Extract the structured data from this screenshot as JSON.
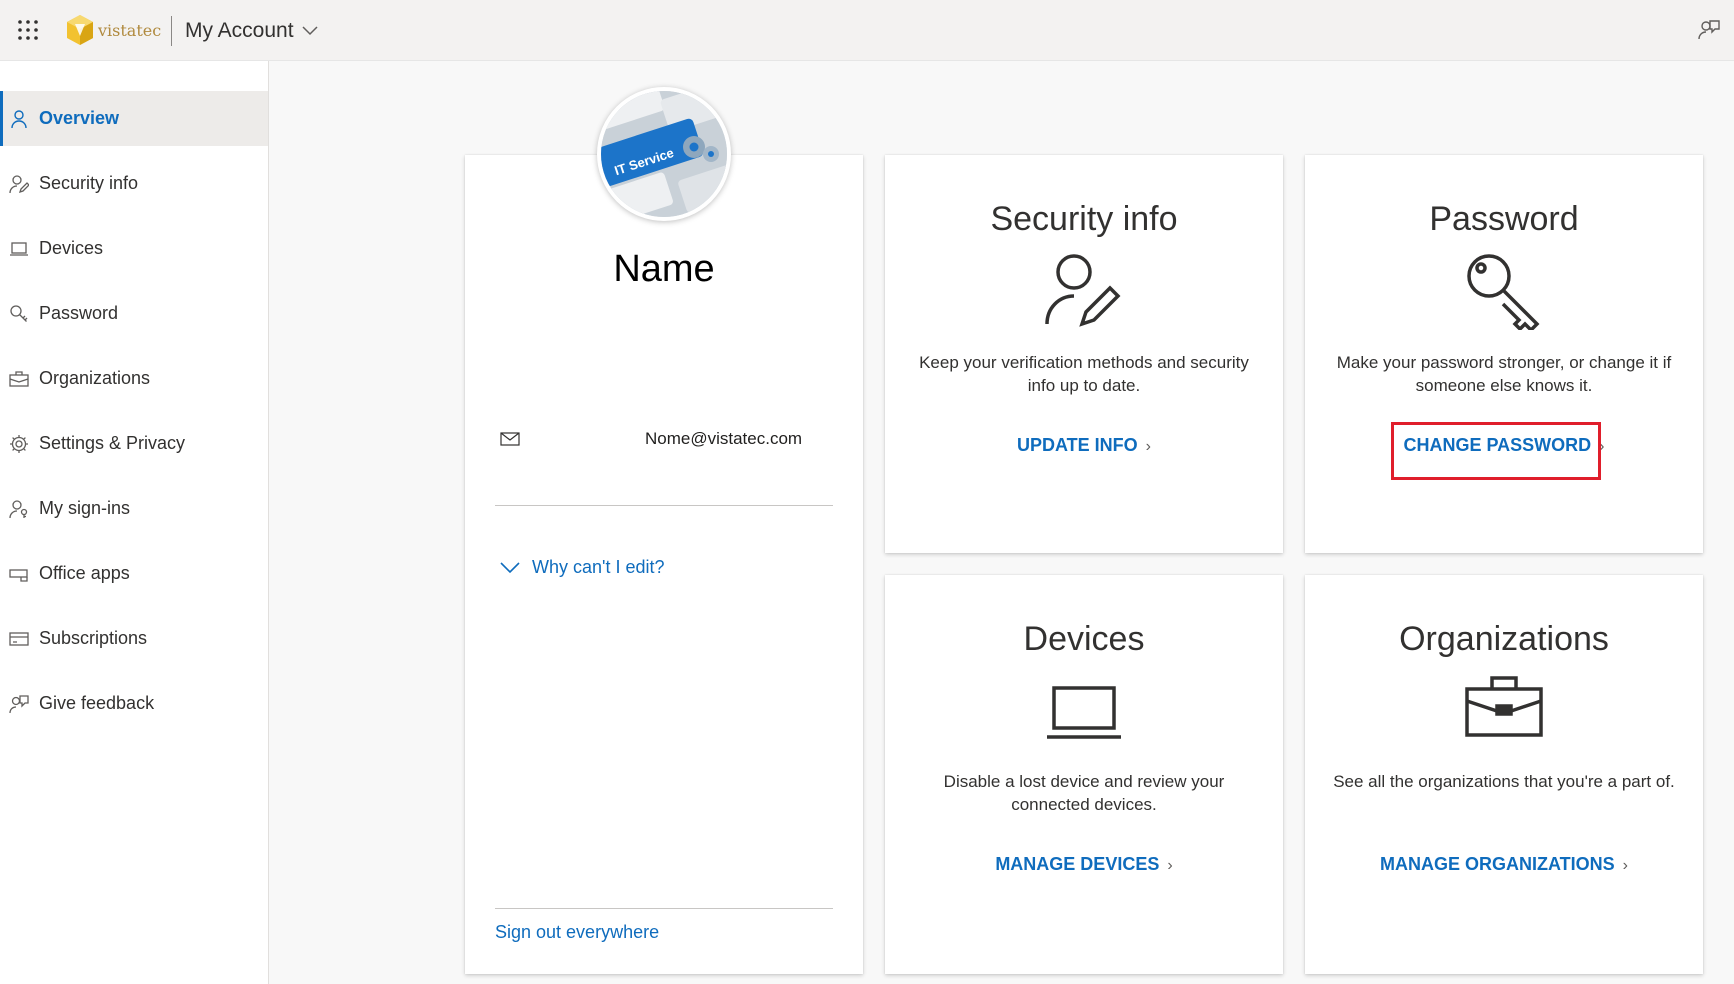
{
  "header": {
    "logo_text": "vistatec",
    "app_title": "My Account"
  },
  "sidebar": {
    "items": [
      {
        "label": "Overview",
        "icon": "person-icon",
        "active": true
      },
      {
        "label": "Security info",
        "icon": "person-edit-icon"
      },
      {
        "label": "Devices",
        "icon": "laptop-icon"
      },
      {
        "label": "Password",
        "icon": "key-icon"
      },
      {
        "label": "Organizations",
        "icon": "briefcase-icon"
      },
      {
        "label": "Settings & Privacy",
        "icon": "gear-icon"
      },
      {
        "label": "My sign-ins",
        "icon": "person-key-icon"
      },
      {
        "label": "Office apps",
        "icon": "apps-icon"
      },
      {
        "label": "Subscriptions",
        "icon": "card-icon"
      },
      {
        "label": "Give feedback",
        "icon": "feedback-icon"
      }
    ]
  },
  "profile": {
    "avatar_text": "IT Service",
    "name": "Name",
    "email": "Nome@vistatec.com",
    "why_edit": "Why can't I edit?",
    "sign_out": "Sign out everywhere"
  },
  "cards": {
    "security": {
      "title": "Security info",
      "description": "Keep your verification methods and security info up to date.",
      "link": "UPDATE INFO"
    },
    "password": {
      "title": "Password",
      "description": "Make your password stronger, or change it if someone else knows it.",
      "link": "CHANGE PASSWORD"
    },
    "devices": {
      "title": "Devices",
      "description": "Disable a lost device and review your connected devices.",
      "link": "MANAGE DEVICES"
    },
    "organizations": {
      "title": "Organizations",
      "description": "See all the organizations that you're a part of.",
      "link": "MANAGE ORGANIZATIONS"
    }
  },
  "colors": {
    "accent": "#0f6cbd",
    "highlight": "#e01e2b"
  }
}
